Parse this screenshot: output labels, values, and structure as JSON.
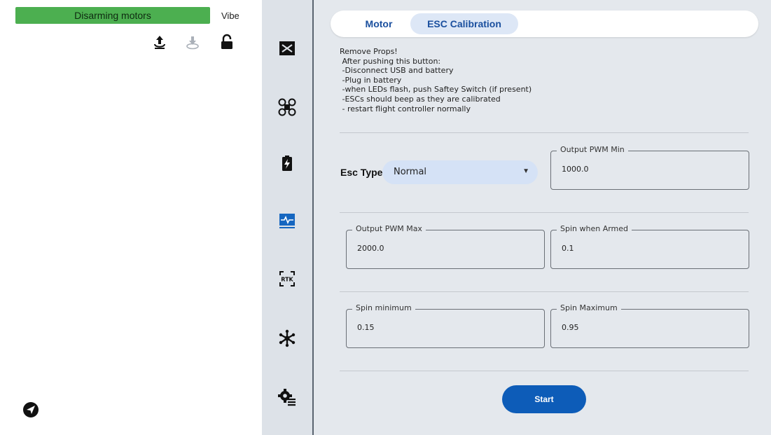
{
  "left_panel": {
    "status_text": "Disarming motors",
    "vibe_label": "Vibe",
    "icons": [
      "upload-icon",
      "download-icon",
      "unlock-icon",
      "send-icon"
    ]
  },
  "rail": {
    "items": [
      "setup-icon",
      "quad-frame-icon",
      "battery-icon",
      "monitor-icon",
      "rtk-icon",
      "hexacopter-icon",
      "settings-gear-icon"
    ],
    "rtk_text": "RTK"
  },
  "tabs": {
    "motor": "Motor",
    "esc_calibration": "ESC Calibration"
  },
  "instructions": [
    "Remove Props!",
    " After pushing this button:",
    " -Disconnect USB and battery",
    " -Plug in battery",
    " -when LEDs flash, push Saftey Switch (if present)",
    " -ESCs should beep as they are calibrated",
    " - restart flight controller normally"
  ],
  "esc_type": {
    "label": "Esc Type",
    "value": "Normal"
  },
  "fields": {
    "pwm_min": {
      "label": "Output PWM Min",
      "value": "1000.0"
    },
    "pwm_max": {
      "label": "Output PWM Max",
      "value": "2000.0"
    },
    "spin_armed": {
      "label": "Spin when Armed",
      "value": "0.1"
    },
    "spin_min": {
      "label": "Spin minimum",
      "value": "0.15"
    },
    "spin_max": {
      "label": "Spin Maximum",
      "value": "0.95"
    }
  },
  "start_label": "Start",
  "colors": {
    "status_green": "#4caf50",
    "accent_blue": "#0d5cb8",
    "tab_text": "#1a4f9e",
    "content_bg": "#e4e8ed"
  }
}
